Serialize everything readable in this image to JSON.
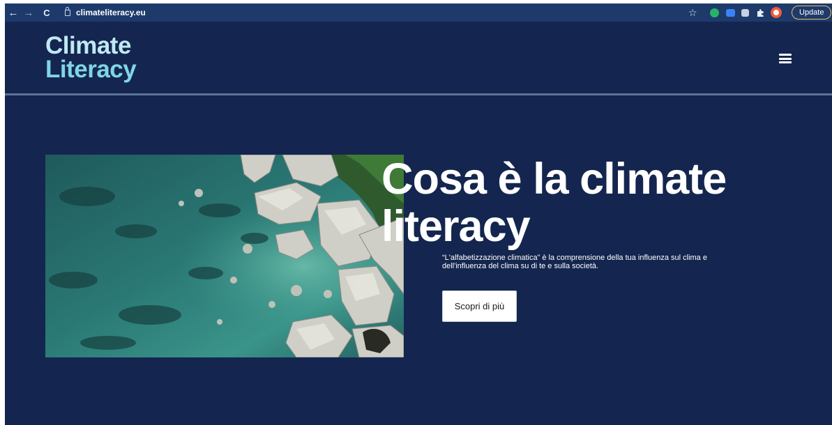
{
  "browser": {
    "url": "climateliteracy.eu",
    "update_label": "Update",
    "back_icon": "←",
    "forward_icon": "→",
    "reload_icon": "C",
    "star_icon": "☆"
  },
  "site": {
    "logo_line1": "Climate",
    "logo_line2": "Literacy"
  },
  "hero": {
    "title": "Cosa è la climate literacy",
    "description": "“L'alfabetizzazione climatica” è la comprensione della tua influenza sul clima e dell'influenza del clima su di te e sulla società.",
    "cta_label": "Scopri di più"
  },
  "colors": {
    "page_bg": "#14264f",
    "chrome_bg": "#1d3a6b",
    "logo_light": "#bfe9f3",
    "logo_accent": "#7fd5e6"
  }
}
